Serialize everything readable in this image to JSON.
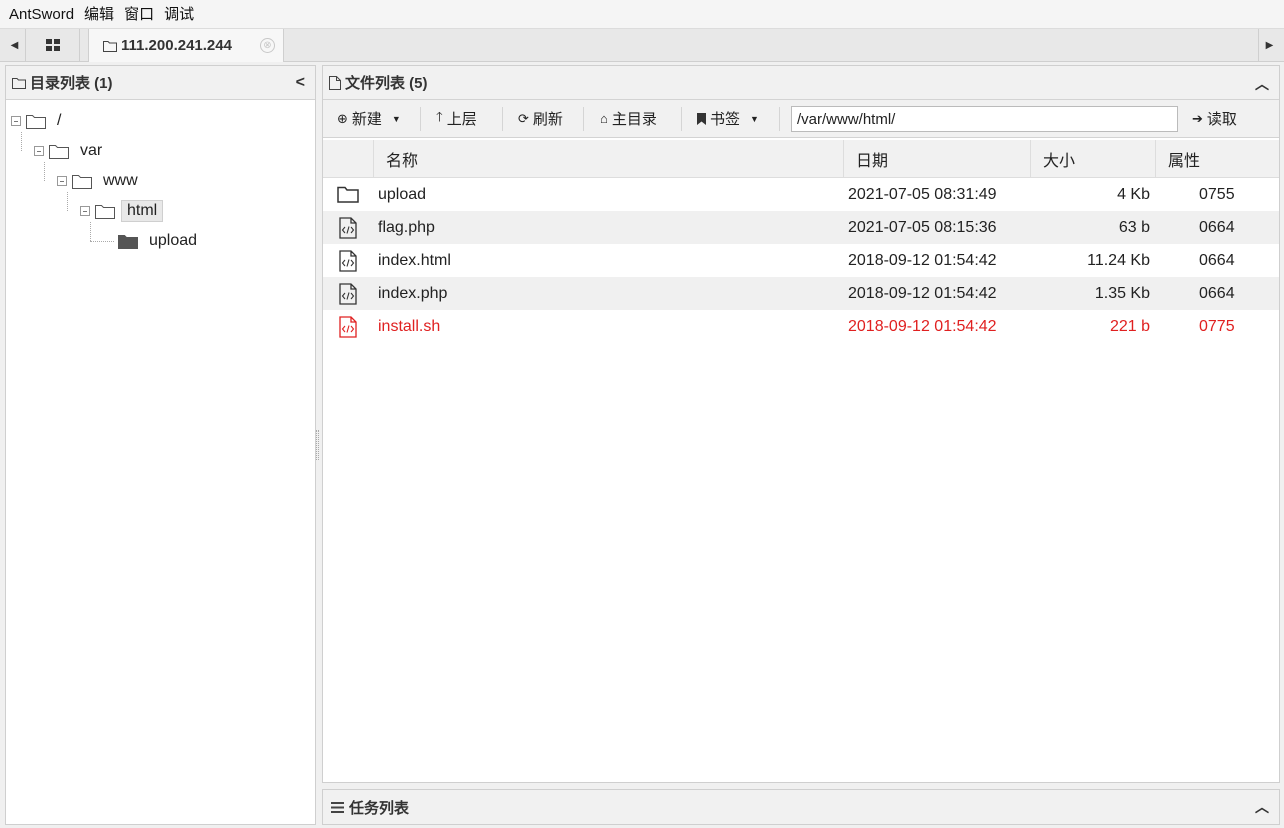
{
  "menu": [
    "AntSword",
    "编辑",
    "窗口",
    "调试"
  ],
  "tabs": {
    "active_label": "111.200.241.244",
    "close_glyph": "⊗"
  },
  "left_panel": {
    "title": "目录列表 (1)",
    "tree": [
      {
        "label": "/",
        "depth": 0,
        "expanded": true,
        "selected": false
      },
      {
        "label": "var",
        "depth": 1,
        "expanded": true,
        "selected": false
      },
      {
        "label": "www",
        "depth": 2,
        "expanded": true,
        "selected": false
      },
      {
        "label": "html",
        "depth": 3,
        "expanded": true,
        "selected": true
      },
      {
        "label": "upload",
        "depth": 4,
        "expanded": false,
        "selected": false
      }
    ]
  },
  "file_panel": {
    "title": "文件列表 (5)",
    "toolbar": {
      "new_label": "新建",
      "up_label": "上层",
      "refresh_label": "刷新",
      "home_label": "主目录",
      "bookmark_label": "书签",
      "path_value": "/var/www/html/",
      "read_label": "读取"
    },
    "columns": [
      "名称",
      "日期",
      "大小",
      "属性"
    ],
    "files": [
      {
        "icon": "folder-icon",
        "name": "upload",
        "date": "2021-07-05 08:31:49",
        "size": "4 Kb",
        "perm": "0755",
        "highlight": false
      },
      {
        "icon": "code-file-icon",
        "name": "flag.php",
        "date": "2021-07-05 08:15:36",
        "size": "63 b",
        "perm": "0664",
        "highlight": false
      },
      {
        "icon": "code-file-icon",
        "name": "index.html",
        "date": "2018-09-12 01:54:42",
        "size": "11.24 Kb",
        "perm": "0664",
        "highlight": false
      },
      {
        "icon": "code-file-icon",
        "name": "index.php",
        "date": "2018-09-12 01:54:42",
        "size": "1.35 Kb",
        "perm": "0664",
        "highlight": false
      },
      {
        "icon": "code-file-icon",
        "name": "install.sh",
        "date": "2018-09-12 01:54:42",
        "size": "221 b",
        "perm": "0775",
        "highlight": true
      }
    ]
  },
  "task_panel": {
    "title": "任务列表"
  },
  "colors": {
    "highlight_row": "#e02020",
    "panel_header_bg": "#f1f1f1"
  }
}
